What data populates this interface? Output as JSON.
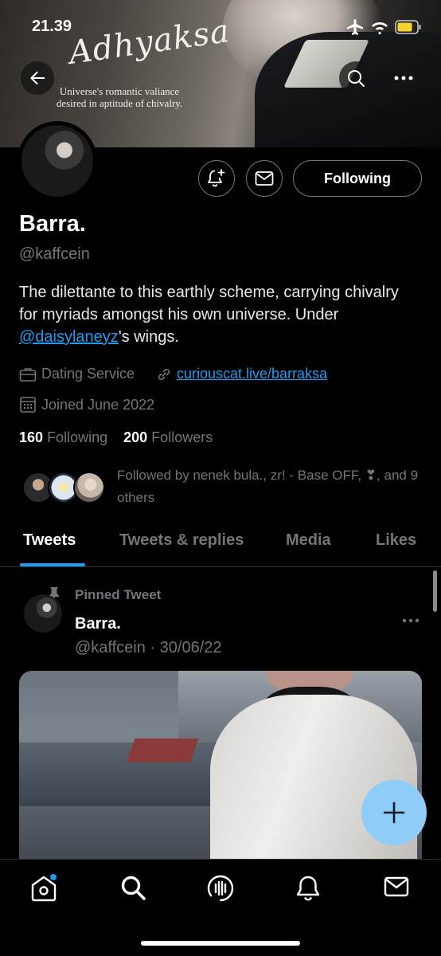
{
  "status_bar": {
    "time": "21.39"
  },
  "banner": {
    "script_title": "Adhyaksa",
    "tagline_line1": "Universe's romantic valiance",
    "tagline_line2": "desired in aptitude of chivalry."
  },
  "profile": {
    "name": "Barra.",
    "handle": "@kaffcein",
    "bio_part1": "The dilettante to this earthly scheme, carrying chivalry for myriads amongst his own universe. Under ",
    "bio_mention": "@daisylaneyz",
    "bio_part2": "'s wings.",
    "category": "Dating Service",
    "website": "curiouscat.live/barraksa",
    "joined": "Joined June 2022",
    "following_count": "160",
    "following_label": "Following",
    "followers_count": "200",
    "followers_label": "Followers",
    "followed_by": "Followed by nenek bula., zr! - Base OFF, ❣, and 9 others",
    "follow_button": "Following"
  },
  "tabs": [
    "Tweets",
    "Tweets & replies",
    "Media",
    "Likes"
  ],
  "pinned_tweet": {
    "pinned_label": "Pinned Tweet",
    "name": "Barra.",
    "handle": "@kaffcein",
    "date": "30/06/22",
    "handle_date": "@kaffcein · 30/06/22"
  },
  "colors": {
    "accent": "#1d9bf0",
    "fab": "#8ecdf8",
    "muted": "#71767b"
  },
  "icons": {
    "back": "arrow-left-icon",
    "search": "search-icon",
    "more": "more-horizontal-icon",
    "notify": "bell-plus-icon",
    "message": "envelope-icon",
    "pin": "pin-icon",
    "nav": [
      "home-icon",
      "search-icon",
      "spaces-icon",
      "bell-icon",
      "mail-icon"
    ]
  }
}
